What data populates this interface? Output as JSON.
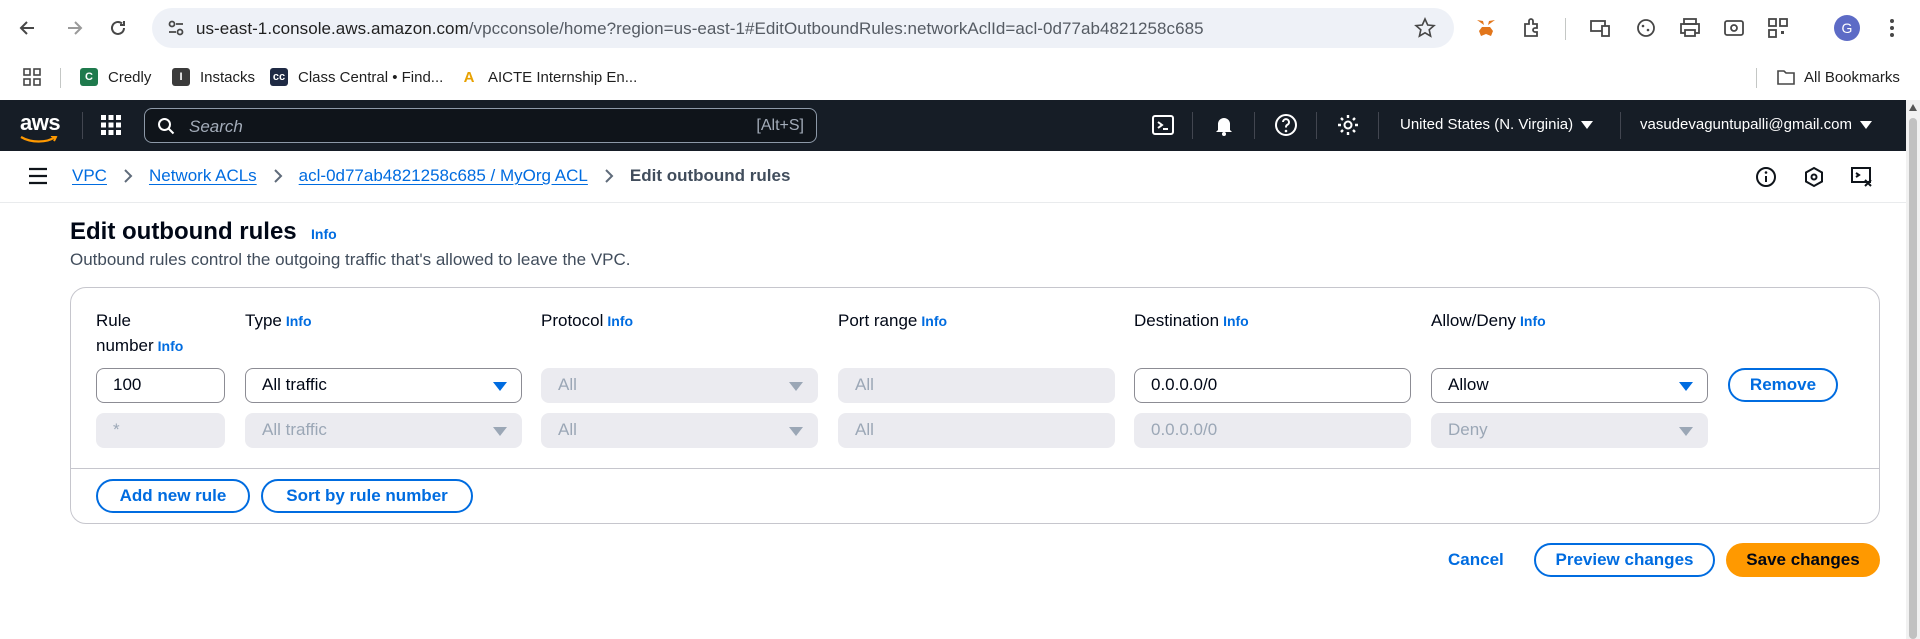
{
  "browser": {
    "url_host": "us-east-1.console.aws.amazon.com",
    "url_path": "/vpcconsole/home?region=us-east-1#EditOutboundRules:networkAclId=acl-0d77ab4821258c685",
    "avatar_letter": "G",
    "bookmarks": [
      {
        "label": "Credly",
        "icon": "credly-icon",
        "color": "#1f7a4d"
      },
      {
        "label": "Instacks",
        "icon": "instacks-icon",
        "color": "#3b3b3b"
      },
      {
        "label": "Class Central • Find...",
        "icon": "classcentral-icon",
        "color": "#1f2a44"
      },
      {
        "label": "AICTE Internship En...",
        "icon": "aicte-icon",
        "color": "#e8a100"
      }
    ],
    "all_bookmarks": "All Bookmarks"
  },
  "aws": {
    "logo_text": "aws",
    "search_placeholder": "Search",
    "search_shortcut": "[Alt+S]",
    "region": "United States (N. Virginia)",
    "account": "vasudevaguntupalli@gmail.com"
  },
  "breadcrumb": {
    "items": [
      "VPC",
      "Network ACLs",
      "acl-0d77ab4821258c685 / MyOrg ACL"
    ],
    "current": "Edit outbound rules"
  },
  "page": {
    "title": "Edit outbound rules",
    "info": "Info",
    "description": "Outbound rules control the outgoing traffic that's allowed to leave the VPC."
  },
  "columns": {
    "rule_number_1": "Rule",
    "rule_number_2": "number",
    "type": "Type",
    "protocol": "Protocol",
    "port_range": "Port range",
    "destination": "Destination",
    "allow_deny": "Allow/Deny",
    "info": "Info"
  },
  "rules": [
    {
      "number": "100",
      "type": "All traffic",
      "protocol": "All",
      "port_range": "All",
      "destination": "0.0.0.0/0",
      "action": "Allow",
      "remove": "Remove"
    },
    {
      "number": "*",
      "type": "All traffic",
      "protocol": "All",
      "port_range": "All",
      "destination": "0.0.0.0/0",
      "action": "Deny"
    }
  ],
  "actions": {
    "add_rule": "Add new rule",
    "sort": "Sort by rule number",
    "cancel": "Cancel",
    "preview": "Preview changes",
    "save": "Save changes"
  },
  "colors": {
    "aws_bar": "#161d26",
    "link": "#006ce0",
    "primary": "#ff9900"
  }
}
